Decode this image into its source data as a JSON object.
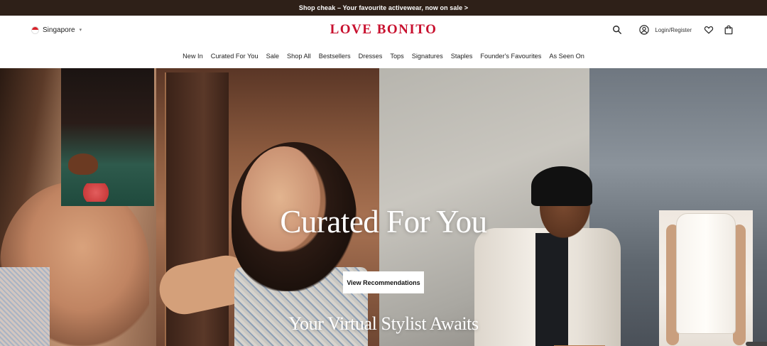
{
  "announcement": {
    "text": "Shop cheak – Your favourite activewear, now on sale >"
  },
  "header": {
    "region": "Singapore",
    "logo": "LOVE BONITO",
    "login_label": "Login/Register",
    "icons": [
      "search-icon",
      "user-icon",
      "heart-icon",
      "bag-icon"
    ],
    "brand_color": "#c8102e"
  },
  "nav": {
    "items": [
      "New In",
      "Curated For You",
      "Sale",
      "Shop All",
      "Bestsellers",
      "Dresses",
      "Tops",
      "Signatures",
      "Staples",
      "Founder's Favourites",
      "As Seen On"
    ]
  },
  "hero": {
    "title": "Curated For You",
    "cta_label": "View Recommendations",
    "subtitle": "Your Virtual Stylist Awaits"
  }
}
